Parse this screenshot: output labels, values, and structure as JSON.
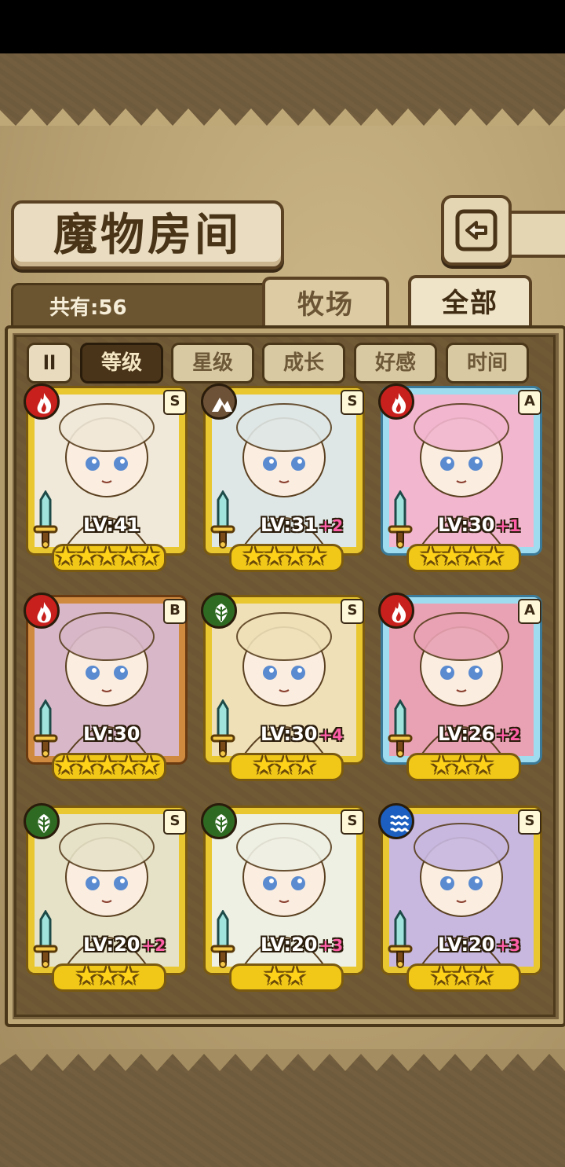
{
  "header": {
    "title": "魔物房间",
    "back_icon": "back-arrow-icon"
  },
  "counter": {
    "label": "共有:56"
  },
  "tabs": [
    {
      "label": "牧场",
      "active": false
    },
    {
      "label": "全部",
      "active": true
    }
  ],
  "sort_toggle": {
    "label": "ll"
  },
  "sort_buttons": [
    {
      "label": "等级",
      "active": true
    },
    {
      "label": "星级",
      "active": false
    },
    {
      "label": "成长",
      "active": false
    },
    {
      "label": "好感",
      "active": false
    },
    {
      "label": "时间",
      "active": false
    }
  ],
  "monsters": [
    {
      "element": "fire",
      "rank": "S",
      "level": "LV:41",
      "plus": "",
      "stars": 5,
      "frame": "gold"
    },
    {
      "element": "earth",
      "rank": "S",
      "level": "LV:31",
      "plus": "+2",
      "stars": 4,
      "frame": "gold"
    },
    {
      "element": "fire",
      "rank": "A",
      "level": "LV:30",
      "plus": "+1",
      "stars": 4,
      "frame": "blue"
    },
    {
      "element": "fire",
      "rank": "B",
      "level": "LV:30",
      "plus": "",
      "stars": 5,
      "frame": "bronze"
    },
    {
      "element": "wood",
      "rank": "S",
      "level": "LV:30",
      "plus": "+4",
      "stars": 3,
      "frame": "gold"
    },
    {
      "element": "fire",
      "rank": "A",
      "level": "LV:26",
      "plus": "+2",
      "stars": 3,
      "frame": "blue"
    },
    {
      "element": "wood",
      "rank": "S",
      "level": "LV:20",
      "plus": "+2",
      "stars": 3,
      "frame": "gold"
    },
    {
      "element": "wood",
      "rank": "S",
      "level": "LV:20",
      "plus": "+3",
      "stars": 2,
      "frame": "gold"
    },
    {
      "element": "water",
      "rank": "S",
      "level": "LV:20",
      "plus": "+3",
      "stars": 3,
      "frame": "gold"
    }
  ],
  "colors": {
    "fire": "#c8201c",
    "earth": "#6e5238",
    "wood": "#2f6a22",
    "water": "#1c5fc0"
  }
}
